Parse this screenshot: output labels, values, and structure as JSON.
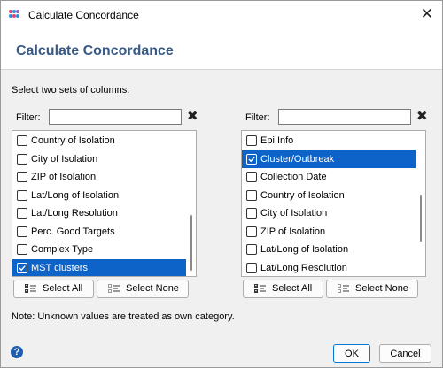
{
  "window": {
    "title": "Calculate Concordance",
    "close_glyph": "✕"
  },
  "header": {
    "title": "Calculate Concordance"
  },
  "instructions": "Select two sets of columns:",
  "left": {
    "filter_label": "Filter:",
    "filter_value": "",
    "items": [
      {
        "label": "Country of Isolation",
        "checked": false,
        "selected": false
      },
      {
        "label": "City of Isolation",
        "checked": false,
        "selected": false
      },
      {
        "label": "ZIP of Isolation",
        "checked": false,
        "selected": false
      },
      {
        "label": "Lat/Long of Isolation",
        "checked": false,
        "selected": false
      },
      {
        "label": "Lat/Long Resolution",
        "checked": false,
        "selected": false
      },
      {
        "label": "Perc. Good Targets",
        "checked": false,
        "selected": false
      },
      {
        "label": "Complex Type",
        "checked": false,
        "selected": false
      },
      {
        "label": "MST clusters",
        "checked": true,
        "selected": true
      }
    ],
    "select_all": "Select All",
    "select_none": "Select None"
  },
  "right": {
    "filter_label": "Filter:",
    "filter_value": "",
    "items": [
      {
        "label": "Epi Info",
        "checked": false,
        "selected": false
      },
      {
        "label": "Cluster/Outbreak",
        "checked": true,
        "selected": true
      },
      {
        "label": "Collection Date",
        "checked": false,
        "selected": false
      },
      {
        "label": "Country of Isolation",
        "checked": false,
        "selected": false
      },
      {
        "label": "City of Isolation",
        "checked": false,
        "selected": false
      },
      {
        "label": "ZIP of Isolation",
        "checked": false,
        "selected": false
      },
      {
        "label": "Lat/Long of Isolation",
        "checked": false,
        "selected": false
      },
      {
        "label": "Lat/Long Resolution",
        "checked": false,
        "selected": false
      }
    ],
    "select_all": "Select All",
    "select_none": "Select None"
  },
  "note": "Note: Unknown values are treated as own category.",
  "footer": {
    "help_glyph": "?",
    "ok": "OK",
    "cancel": "Cancel"
  },
  "icons": {
    "app": "app-dots-icon",
    "clear": "clear-filter-x-icon",
    "help": "help-icon",
    "select_all": "select-all-list-icon",
    "select_none": "select-none-list-icon"
  },
  "colors": {
    "header_title": "#3a5a86",
    "selection": "#0d63c8",
    "ok_border": "#0078d4"
  }
}
